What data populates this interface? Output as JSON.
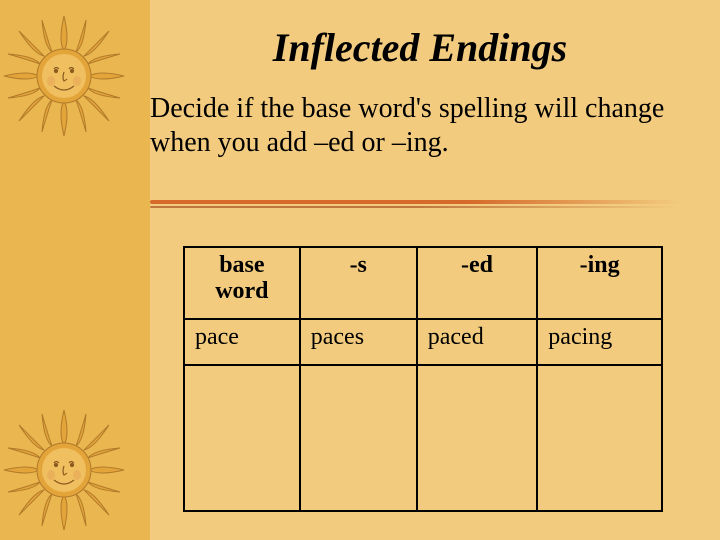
{
  "title": "Inflected Endings",
  "subtitle": "Decide if the base word's spelling will change when you add –ed or –ing.",
  "table": {
    "headers": [
      "base word",
      "-s",
      "-ed",
      "-ing"
    ],
    "row": [
      "pace",
      "paces",
      "paced",
      "pacing"
    ]
  },
  "colors": {
    "sun_body": "#e3a43a",
    "sun_dark": "#b07a2a",
    "sun_hi": "#f5d07a",
    "face": "#8a5a20"
  }
}
